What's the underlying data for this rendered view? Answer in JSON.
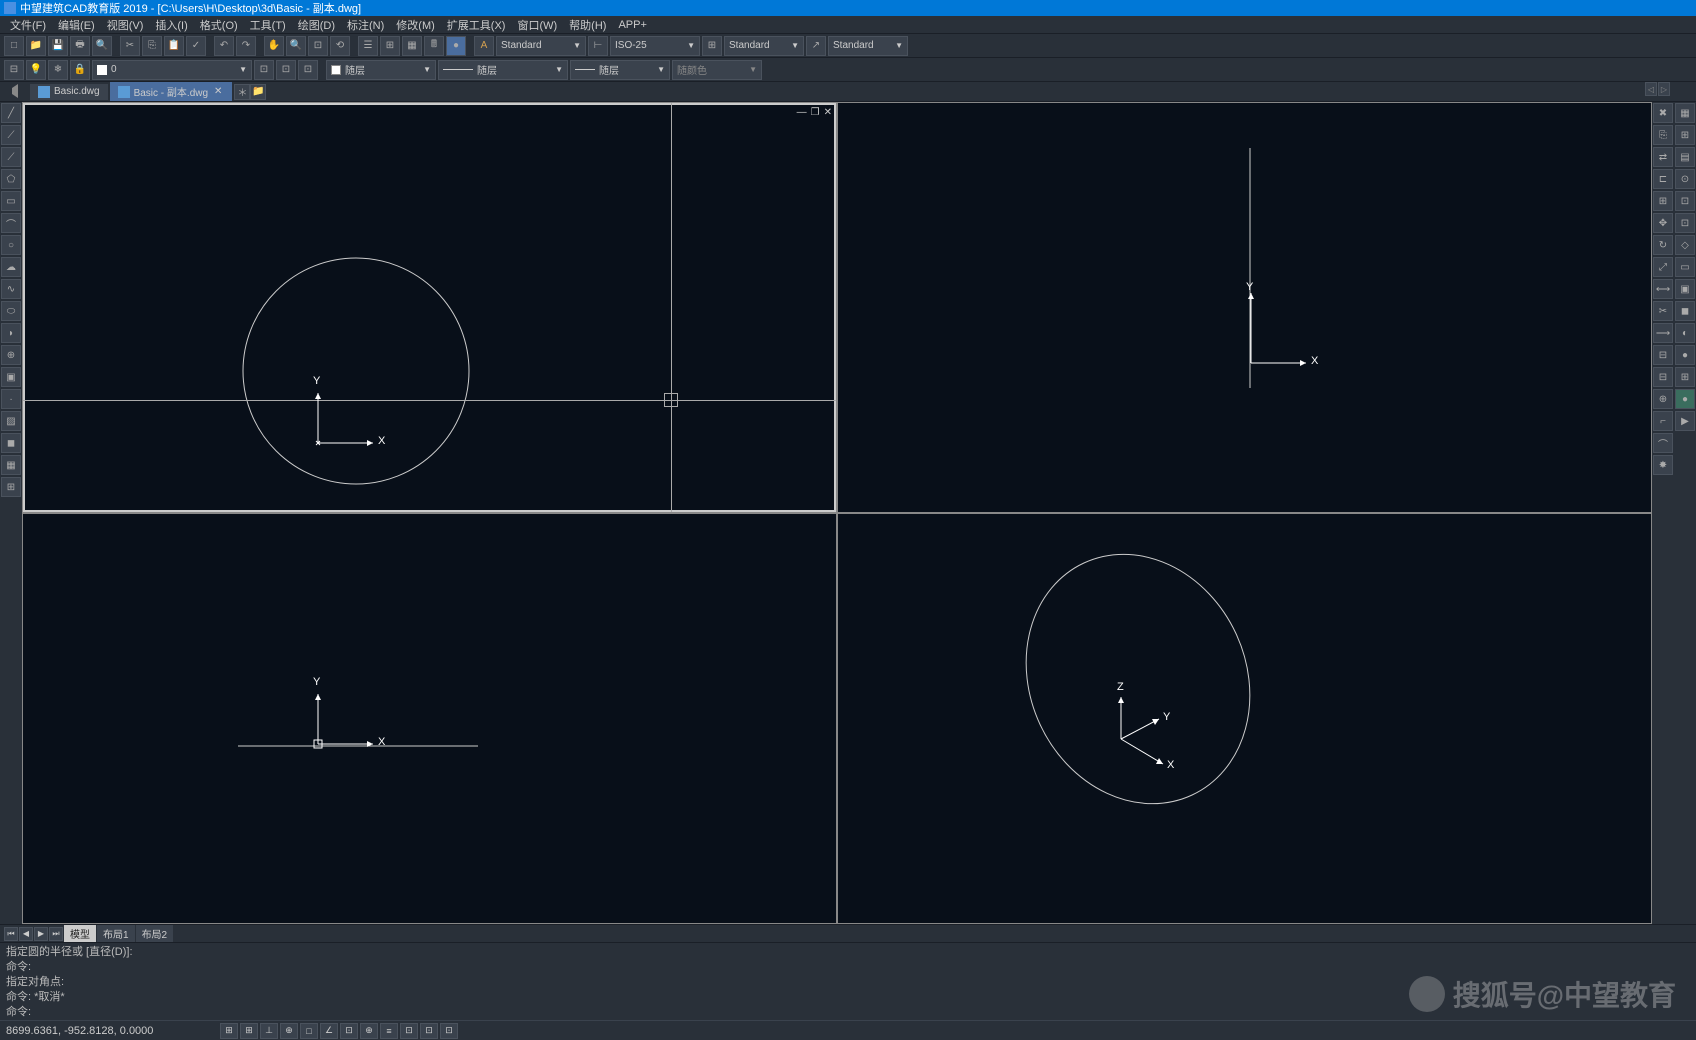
{
  "title": "中望建筑CAD教育版 2019 - [C:\\Users\\H\\Desktop\\3d\\Basic - 副本.dwg]",
  "menu": [
    "文件(F)",
    "编辑(E)",
    "视图(V)",
    "插入(I)",
    "格式(O)",
    "工具(T)",
    "绘图(D)",
    "标注(N)",
    "修改(M)",
    "扩展工具(X)",
    "窗口(W)",
    "帮助(H)",
    "APP+"
  ],
  "toolbar1": {
    "style1": "Standard",
    "style2": "ISO-25",
    "style3": "Standard",
    "style4": "Standard"
  },
  "layer_row": {
    "layer_num": "0",
    "dd1": "随层",
    "dd2": "随层",
    "dd3": "随层",
    "dd4": "随颜色"
  },
  "tabs": [
    {
      "label": "Basic.dwg",
      "active": false
    },
    {
      "label": "Basic - 副本.dwg",
      "active": true
    }
  ],
  "layout_tabs": [
    "模型",
    "布局1",
    "布局2"
  ],
  "cmd": {
    "l1": "指定圆的半径或 [直径(D)]:",
    "l2": "命令:",
    "l3": "指定对角点:",
    "l4": "命令: *取消*",
    "l5": "命令:"
  },
  "status": {
    "coords": "8699.6361, -952.8128, 0.0000"
  },
  "watermark": "搜狐号@中望教育",
  "axis": {
    "x": "X",
    "y": "Y",
    "z": "Z"
  }
}
